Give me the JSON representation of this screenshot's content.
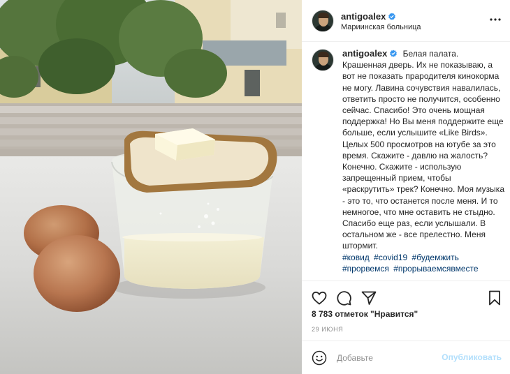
{
  "post": {
    "username": "antigoalex",
    "location": "Мариинская больница",
    "caption": "Белая палата. Крашенная дверь. Их не показываю, а вот не показать прародителя кинокорма не могу. Лавина сочувствия навалилась, ответить просто не получится, особенно сейчас. Спасибо! Это очень мощная поддержка! Но Вы меня поддержите еще больше, если услышите «Like Birds». Целых 500 просмотров на ютубе за это время. Скажите - давлю на жалость? Конечно. Скажите - использую запрещенный прием, чтобы «раскрутить» трек? Конечно. Моя музыка - это то, что останется после меня. И то немногое, что мне оставить не стыдно. Спасибо еще раз, если услышали. В остальном же - все прелестно. Меня штормит.",
    "hashtags": [
      "#ковид",
      "#covid19",
      "#будемжить",
      "#прорвемся",
      "#прорываемсявместе"
    ],
    "likes": "8 783 отметок \"Нравится\"",
    "date": "29 июня"
  },
  "icons": {
    "verified": "verified-badge-icon",
    "more": "more-options-icon",
    "like": "heart-icon",
    "comment": "comment-bubble-icon",
    "share": "paper-plane-icon",
    "save": "bookmark-icon",
    "emoji": "smiley-icon"
  },
  "comment": {
    "placeholder": "Добавьте",
    "publish_label": "Опубликовать"
  },
  "colors": {
    "verified": "#3897f0",
    "hashtag": "#00376b",
    "publish_disabled": "#b2dffc"
  }
}
